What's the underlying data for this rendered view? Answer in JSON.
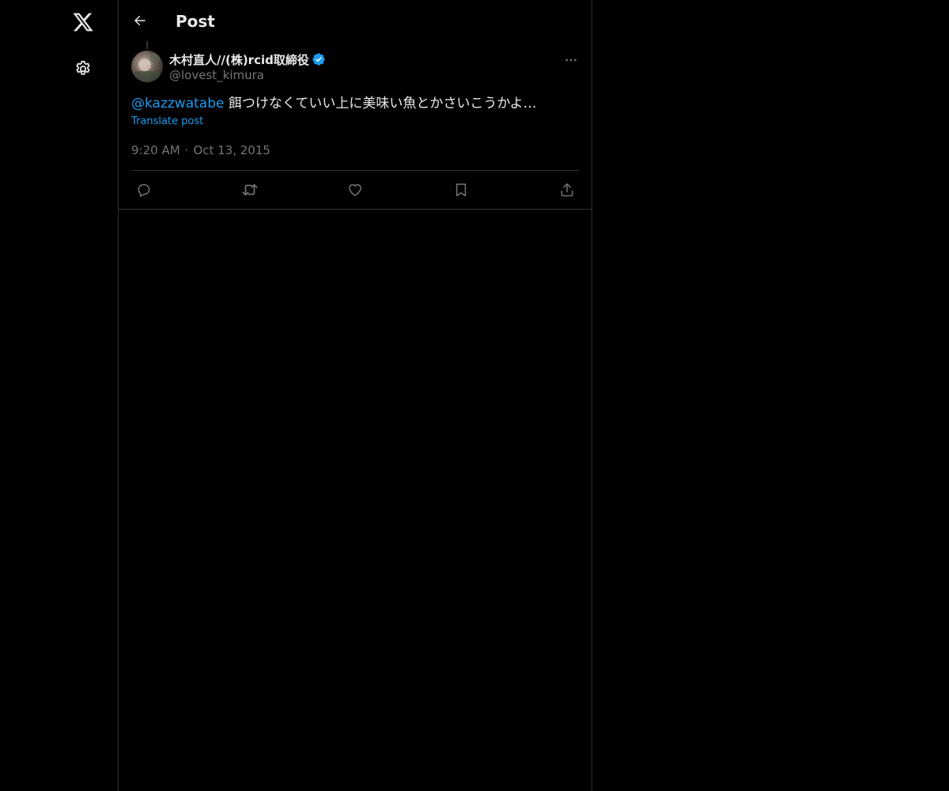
{
  "colors": {
    "background": "#000000",
    "text_primary": "#e7e9ea",
    "text_secondary": "#71767b",
    "accent": "#1d9bf0",
    "border": "#2f3336"
  },
  "nav": {
    "logo_icon": "x-logo-icon",
    "settings_icon": "gear-icon"
  },
  "header": {
    "back_icon": "arrow-left-icon",
    "title": "Post"
  },
  "post": {
    "author": {
      "display_name": "木村直人//(株)rcid取締役",
      "handle": "@lovest_kimura",
      "verified": true
    },
    "mention": "@kazzwatabe",
    "text": " 餌つけなくていい上に美味い魚とかさいこうかよ…",
    "translate_label": "Translate post",
    "time": "9:20 AM",
    "separator": "·",
    "date": "Oct 13, 2015"
  },
  "actions": [
    {
      "name": "reply",
      "icon": "reply-icon"
    },
    {
      "name": "repost",
      "icon": "repost-icon"
    },
    {
      "name": "like",
      "icon": "heart-icon"
    },
    {
      "name": "bookmark",
      "icon": "bookmark-icon"
    },
    {
      "name": "share",
      "icon": "share-icon"
    }
  ]
}
